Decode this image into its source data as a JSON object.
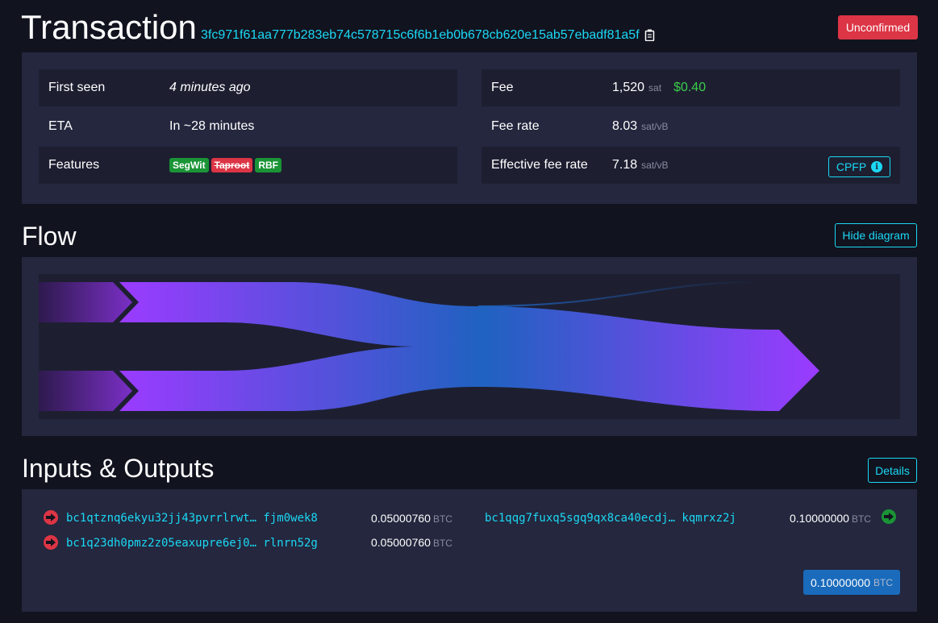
{
  "header": {
    "title": "Transaction",
    "txid": "3fc971f61aa777b283eb74c578715c6f6b1eb0b678cb620e15ab57ebadf81a5f",
    "status": "Unconfirmed"
  },
  "details": {
    "first_seen": {
      "label": "First seen",
      "value": "4 minutes ago"
    },
    "eta": {
      "label": "ETA",
      "value": "In ~28 minutes"
    },
    "features": {
      "label": "Features",
      "tags": [
        "SegWit",
        "Taproot",
        "RBF"
      ]
    },
    "fee": {
      "label": "Fee",
      "value": "1,520",
      "unit": "sat",
      "fiat": "$0.40"
    },
    "fee_rate": {
      "label": "Fee rate",
      "value": "8.03",
      "unit": "sat/vB"
    },
    "effective_fee_rate": {
      "label": "Effective fee rate",
      "value": "7.18",
      "unit": "sat/vB",
      "button": "CPFP"
    }
  },
  "flow": {
    "title": "Flow",
    "toggle_label": "Hide diagram"
  },
  "io": {
    "title": "Inputs & Outputs",
    "details_label": "Details",
    "inputs": [
      {
        "address": "bc1qtznq6ekyu32jj43pvrrlrwt… fjm0wek8",
        "amount": "0.05000760",
        "unit": "BTC"
      },
      {
        "address": "bc1q23dh0pmz2z05eaxupre6ej0… rlnrn52g",
        "amount": "0.05000760",
        "unit": "BTC"
      }
    ],
    "outputs": [
      {
        "address": "bc1qqg7fuxq5sgq9qx8ca40ecdj… kqmrxz2j",
        "amount": "0.10000000",
        "unit": "BTC"
      }
    ],
    "total": {
      "amount": "0.10000000",
      "unit": "BTC"
    }
  },
  "colors": {
    "accent": "#1bd8f4",
    "danger": "#dc3545",
    "success": "#1a9436",
    "background": "#11131f",
    "panel": "#24273e"
  }
}
